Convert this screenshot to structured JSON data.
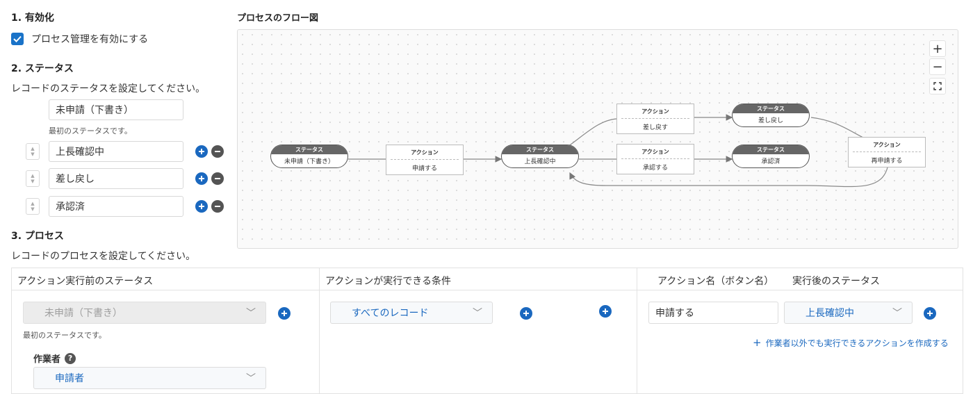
{
  "section1": {
    "title": "1. 有効化",
    "enable_label": "プロセス管理を有効にする",
    "enabled": true
  },
  "section2": {
    "title": "2. ステータス",
    "description": "レコードのステータスを設定してください。",
    "first_status": "未申請（下書き）",
    "first_status_note": "最初のステータスです。",
    "statuses": [
      "上長確認中",
      "差し戻し",
      "承認済"
    ]
  },
  "section3": {
    "title": "3. プロセス",
    "description": "レコードのプロセスを設定してください。"
  },
  "flow": {
    "title": "プロセスのフロー図",
    "zoom_in": "+",
    "zoom_out": "−",
    "fit_icon": "fit-screen-icon",
    "status_header": "ステータス",
    "action_header": "アクション",
    "nodes": {
      "s1": "未申請（下書き）",
      "a1": "申請する",
      "s2": "上長確認中",
      "a2": "差し戻す",
      "a3": "承認する",
      "s3": "差し戻し",
      "s4": "承認済",
      "a4": "再申請する"
    }
  },
  "process_table": {
    "headers": {
      "before_status": "アクション実行前のステータス",
      "condition": "アクションが実行できる条件",
      "action_name": "アクション名（ボタン名）",
      "after_status": "実行後のステータス"
    },
    "row": {
      "before_status_value": "未申請（下書き）",
      "before_status_note": "最初のステータスです。",
      "condition_value": "すべてのレコード",
      "action_name_value": "申請する",
      "after_status_value": "上長確認中",
      "create_action_link": "作業者以外でも実行できるアクションを作成する",
      "assignee_label": "作業者",
      "assignee_value": "申請者"
    }
  },
  "colors": {
    "accent": "#1a68bf",
    "checkbox": "#1a73c8",
    "remove_button": "#545454"
  }
}
